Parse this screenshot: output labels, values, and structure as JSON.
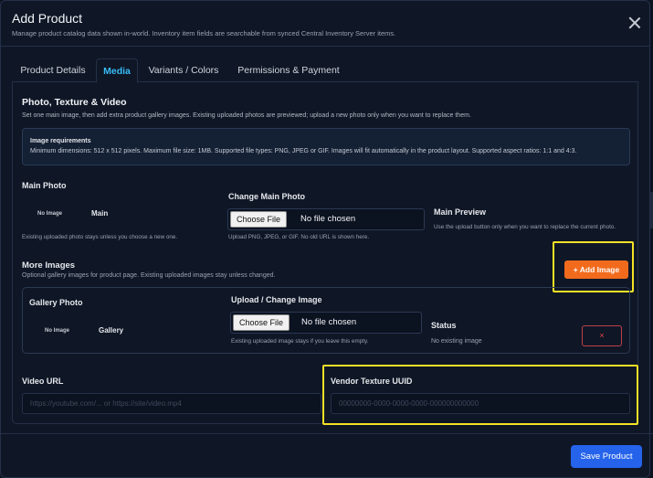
{
  "header": {
    "title": "Add Product",
    "subtitle": "Manage product catalog data shown in-world. Inventory item fields are searchable from synced Central Inventory Server items."
  },
  "tabs": [
    {
      "label": "Product Details",
      "active": false
    },
    {
      "label": "Media",
      "active": true
    },
    {
      "label": "Variants / Colors",
      "active": false
    },
    {
      "label": "Permissions & Payment",
      "active": false
    }
  ],
  "media": {
    "section_title": "Photo, Texture & Video",
    "section_desc": "Set one main image, then add extra product gallery images. Existing uploaded photos are previewed; upload a new photo only when you want to replace them.",
    "requirements": {
      "title": "Image requirements",
      "text": "Minimum dimensions: 512 x 512 pixels. Maximum file size: 1MB. Supported file types: PNG, JPEG or GIF. Images will fit automatically in the product layout. Supported aspect ratios: 1:1 and 4:3."
    },
    "main_photo": {
      "label": "Main Photo",
      "no_image": "No Image",
      "tag": "Main",
      "help": "Existing uploaded photo stays unless you choose a new one."
    },
    "change_main": {
      "label": "Change Main Photo",
      "button": "Choose File",
      "status": "No file chosen",
      "help": "Upload PNG, JPEG, or GIF. No old URL is shown here."
    },
    "main_preview": {
      "label": "Main Preview",
      "help": "Use the upload button only when you want to replace the current photo."
    },
    "more_images": {
      "title": "More Images",
      "desc": "Optional gallery images for product page. Existing uploaded images stay unless changed.",
      "add_button": "+ Add Image"
    },
    "gallery": {
      "label": "Gallery Photo",
      "no_image": "No Image",
      "tag": "Gallery",
      "upload_label": "Upload / Change Image",
      "button": "Choose File",
      "file_status": "No file chosen",
      "help": "Existing uploaded image stays if you leave this empty.",
      "status_label": "Status",
      "status_value": "No existing image",
      "remove": "×"
    },
    "video_url": {
      "label": "Video URL",
      "placeholder": "https://youtube.com/... or https://site/video.mp4"
    },
    "vendor_texture": {
      "label": "Vendor Texture UUID",
      "placeholder": "00000000-0000-0000-0000-000000000000"
    }
  },
  "footer": {
    "save": "Save Product"
  },
  "colors": {
    "accent": "#38bdf8",
    "orange": "#f26b1d",
    "primary": "#2563eb",
    "highlight": "#f5e125",
    "danger": "#ef4444"
  }
}
